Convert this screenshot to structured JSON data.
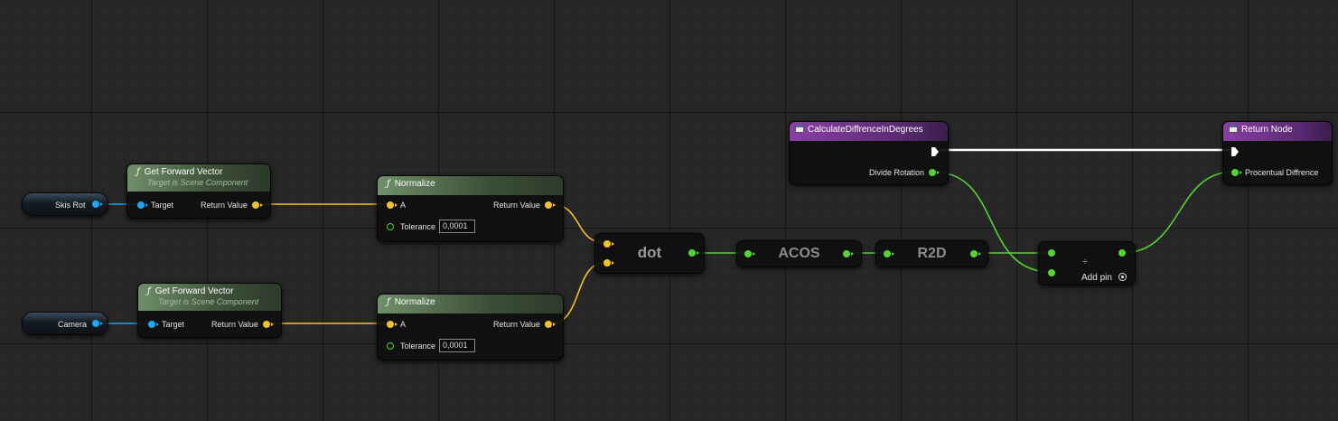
{
  "nodes": {
    "skis_rot": {
      "label": "Skis Rot"
    },
    "camera": {
      "label": "Camera"
    },
    "forward1": {
      "title": "Get Forward Vector",
      "subtitle": "Target is Scene Component",
      "target": "Target",
      "return": "Return Value"
    },
    "forward2": {
      "title": "Get Forward Vector",
      "subtitle": "Target is Scene Component",
      "target": "Target",
      "return": "Return Value"
    },
    "normalize1": {
      "title": "Normalize",
      "a": "A",
      "return": "Return Value",
      "tolerance_label": "Tolerance",
      "tolerance_value": "0,0001"
    },
    "normalize2": {
      "title": "Normalize",
      "a": "A",
      "return": "Return Value",
      "tolerance_label": "Tolerance",
      "tolerance_value": "0,0001"
    },
    "dot": {
      "label": "dot"
    },
    "acos": {
      "label": "ACOS"
    },
    "r2d": {
      "label": "R2D"
    },
    "divide": {
      "symbol": "÷",
      "add_pin": "Add pin"
    },
    "entry": {
      "title": "CalculateDiffrenceInDegrees",
      "output": "Divide Rotation"
    },
    "return_node": {
      "title": "Return Node",
      "input": "Procentual Diffrence"
    }
  },
  "function_glyph": "ƒ",
  "icons": {
    "function": "function-icon",
    "event": "function-entry-icon",
    "add_pin": "add-pin-icon"
  },
  "colors": {
    "vector_pin": "#f2c22c",
    "object_pin": "#1ea6f0",
    "float_pin": "#56d236",
    "exec_pin": "#ffffff",
    "function_header": "#6f8f69",
    "entry_header": "#8a3fa4"
  }
}
